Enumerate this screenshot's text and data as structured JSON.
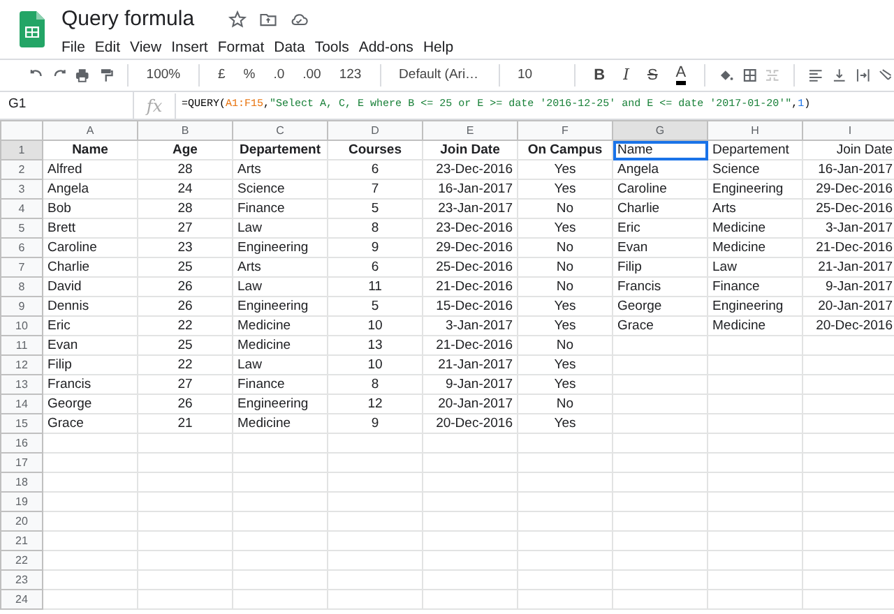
{
  "document": {
    "title": "Query formula"
  },
  "menus": [
    "File",
    "Edit",
    "View",
    "Insert",
    "Format",
    "Data",
    "Tools",
    "Add-ons",
    "Help"
  ],
  "toolbar": {
    "zoom": "100%",
    "currency": "£",
    "percent": "%",
    "decimal_less": ".0",
    "decimal_more": ".00",
    "number_format": "123",
    "font": "Default (Ari…",
    "font_size": "10",
    "bold": "B",
    "italic": "I",
    "strikethrough": "S",
    "text_color": "A",
    "merge_disabled": true
  },
  "formula_bar": {
    "name_box": "G1",
    "fx_label": "fx",
    "tokens": [
      {
        "kind": "function",
        "text": "=QUERY("
      },
      {
        "kind": "range",
        "text": "A1:F15"
      },
      {
        "kind": "punct",
        "text": ","
      },
      {
        "kind": "string",
        "text": "\"Select A, C, E where B <= 25 or E >= date '2016-12-25' and E <= date '2017-01-20'\""
      },
      {
        "kind": "punct",
        "text": ","
      },
      {
        "kind": "number",
        "text": "1"
      },
      {
        "kind": "function",
        "text": ")"
      }
    ]
  },
  "grid": {
    "columns": [
      {
        "letter": "A",
        "selected": false
      },
      {
        "letter": "B",
        "selected": false
      },
      {
        "letter": "C",
        "selected": false
      },
      {
        "letter": "D",
        "selected": false
      },
      {
        "letter": "E",
        "selected": false
      },
      {
        "letter": "F",
        "selected": false
      },
      {
        "letter": "G",
        "selected": true
      },
      {
        "letter": "H",
        "selected": false
      },
      {
        "letter": "I",
        "selected": false
      }
    ],
    "rows": [
      {
        "number": "1",
        "selected": true,
        "cells": [
          "Name",
          "Age",
          "Departement",
          "Courses",
          "Join Date",
          "On Campus",
          "Name",
          "Departement",
          "Join Date"
        ]
      },
      {
        "number": "2",
        "selected": false,
        "cells": [
          "Alfred",
          "28",
          "Arts",
          "6",
          "23-Dec-2016",
          "Yes",
          "Angela",
          "Science",
          "16-Jan-2017"
        ]
      },
      {
        "number": "3",
        "selected": false,
        "cells": [
          "Angela",
          "24",
          "Science",
          "7",
          "16-Jan-2017",
          "Yes",
          "Caroline",
          "Engineering",
          "29-Dec-2016"
        ]
      },
      {
        "number": "4",
        "selected": false,
        "cells": [
          "Bob",
          "28",
          "Finance",
          "5",
          "23-Jan-2017",
          "No",
          "Charlie",
          "Arts",
          "25-Dec-2016"
        ]
      },
      {
        "number": "5",
        "selected": false,
        "cells": [
          "Brett",
          "27",
          "Law",
          "8",
          "23-Dec-2016",
          "Yes",
          "Eric",
          "Medicine",
          "3-Jan-2017"
        ]
      },
      {
        "number": "6",
        "selected": false,
        "cells": [
          "Caroline",
          "23",
          "Engineering",
          "9",
          "29-Dec-2016",
          "No",
          "Evan",
          "Medicine",
          "21-Dec-2016"
        ]
      },
      {
        "number": "7",
        "selected": false,
        "cells": [
          "Charlie",
          "25",
          "Arts",
          "6",
          "25-Dec-2016",
          "No",
          "Filip",
          "Law",
          "21-Jan-2017"
        ]
      },
      {
        "number": "8",
        "selected": false,
        "cells": [
          "David",
          "26",
          "Law",
          "11",
          "21-Dec-2016",
          "No",
          "Francis",
          "Finance",
          "9-Jan-2017"
        ]
      },
      {
        "number": "9",
        "selected": false,
        "cells": [
          "Dennis",
          "26",
          "Engineering",
          "5",
          "15-Dec-2016",
          "Yes",
          "George",
          "Engineering",
          "20-Jan-2017"
        ]
      },
      {
        "number": "10",
        "selected": false,
        "cells": [
          "Eric",
          "22",
          "Medicine",
          "10",
          "3-Jan-2017",
          "Yes",
          "Grace",
          "Medicine",
          "20-Dec-2016"
        ]
      },
      {
        "number": "11",
        "selected": false,
        "cells": [
          "Evan",
          "25",
          "Medicine",
          "13",
          "21-Dec-2016",
          "No"
        ]
      },
      {
        "number": "12",
        "selected": false,
        "cells": [
          "Filip",
          "22",
          "Law",
          "10",
          "21-Jan-2017",
          "Yes"
        ]
      },
      {
        "number": "13",
        "selected": false,
        "cells": [
          "Francis",
          "27",
          "Finance",
          "8",
          "9-Jan-2017",
          "Yes"
        ]
      },
      {
        "number": "14",
        "selected": false,
        "cells": [
          "George",
          "26",
          "Engineering",
          "12",
          "20-Jan-2017",
          "No"
        ]
      },
      {
        "number": "15",
        "selected": false,
        "cells": [
          "Grace",
          "21",
          "Medicine",
          "9",
          "20-Dec-2016",
          "Yes"
        ]
      },
      {
        "number": "16",
        "selected": false
      },
      {
        "number": "17",
        "selected": false
      },
      {
        "number": "18",
        "selected": false
      },
      {
        "number": "19",
        "selected": false
      },
      {
        "number": "20",
        "selected": false
      },
      {
        "number": "21",
        "selected": false
      },
      {
        "number": "22",
        "selected": false
      },
      {
        "number": "23",
        "selected": false
      },
      {
        "number": "24",
        "selected": false
      }
    ]
  }
}
